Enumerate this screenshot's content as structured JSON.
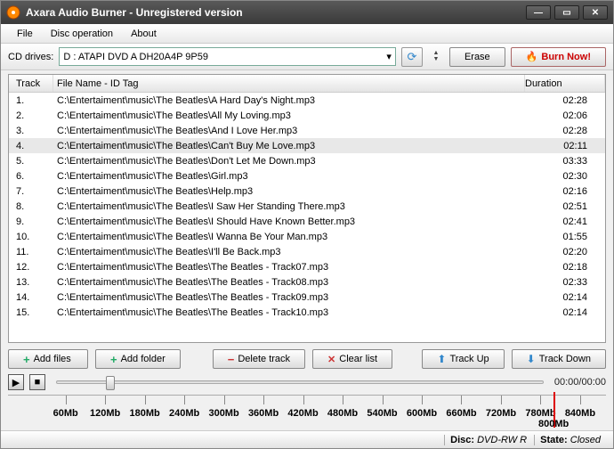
{
  "window": {
    "title": "Axara Audio Burner - Unregistered version"
  },
  "menu": {
    "file": "File",
    "disc": "Disc operation",
    "about": "About"
  },
  "toolbar": {
    "drives_label": "CD drives:",
    "drive_value": "D : ATAPI   DVD A  DH20A4P   9P59",
    "erase": "Erase",
    "burn": "Burn Now!"
  },
  "columns": {
    "track": "Track",
    "file": "File Name - ID Tag",
    "duration": "Duration"
  },
  "tracks": [
    {
      "n": "1.",
      "file": "C:\\Entertaiment\\music\\The Beatles\\A Hard Day's Night.mp3",
      "dur": "02:28"
    },
    {
      "n": "2.",
      "file": "C:\\Entertaiment\\music\\The Beatles\\All My Loving.mp3",
      "dur": "02:06"
    },
    {
      "n": "3.",
      "file": "C:\\Entertaiment\\music\\The Beatles\\And I Love Her.mp3",
      "dur": "02:28"
    },
    {
      "n": "4.",
      "file": "C:\\Entertaiment\\music\\The Beatles\\Can't Buy Me Love.mp3",
      "dur": "02:11"
    },
    {
      "n": "5.",
      "file": "C:\\Entertaiment\\music\\The Beatles\\Don't Let Me Down.mp3",
      "dur": "03:33"
    },
    {
      "n": "6.",
      "file": "C:\\Entertaiment\\music\\The Beatles\\Girl.mp3",
      "dur": "02:30"
    },
    {
      "n": "7.",
      "file": "C:\\Entertaiment\\music\\The Beatles\\Help.mp3",
      "dur": "02:16"
    },
    {
      "n": "8.",
      "file": "C:\\Entertaiment\\music\\The Beatles\\I Saw Her Standing There.mp3",
      "dur": "02:51"
    },
    {
      "n": "9.",
      "file": "C:\\Entertaiment\\music\\The Beatles\\I Should Have Known Better.mp3",
      "dur": "02:41"
    },
    {
      "n": "10.",
      "file": "C:\\Entertaiment\\music\\The Beatles\\I Wanna Be Your Man.mp3",
      "dur": "01:55"
    },
    {
      "n": "11.",
      "file": "C:\\Entertaiment\\music\\The Beatles\\I'll Be Back.mp3",
      "dur": "02:20"
    },
    {
      "n": "12.",
      "file": "C:\\Entertaiment\\music\\The Beatles\\The Beatles - Track07.mp3",
      "dur": "02:18"
    },
    {
      "n": "13.",
      "file": "C:\\Entertaiment\\music\\The Beatles\\The Beatles - Track08.mp3",
      "dur": "02:33"
    },
    {
      "n": "14.",
      "file": "C:\\Entertaiment\\music\\The Beatles\\The Beatles - Track09.mp3",
      "dur": "02:14"
    },
    {
      "n": "15.",
      "file": "C:\\Entertaiment\\music\\The Beatles\\The Beatles - Track10.mp3",
      "dur": "02:14"
    }
  ],
  "selected_index": 3,
  "buttons": {
    "add_files": "Add files",
    "add_folder": "Add folder",
    "delete_track": "Delete track",
    "clear_list": "Clear list",
    "track_up": "Track Up",
    "track_down": "Track Down"
  },
  "playback": {
    "time": "00:00/00:00"
  },
  "ruler": {
    "ticks": [
      "60Mb",
      "120Mb",
      "180Mb",
      "240Mb",
      "300Mb",
      "360Mb",
      "420Mb",
      "480Mb",
      "540Mb",
      "600Mb",
      "660Mb",
      "720Mb",
      "780Mb",
      "840Mb"
    ],
    "capacity_label": "800Mb"
  },
  "status": {
    "disc_label": "Disc:",
    "disc_value": "DVD-RW R",
    "state_label": "State:",
    "state_value": "Closed"
  }
}
